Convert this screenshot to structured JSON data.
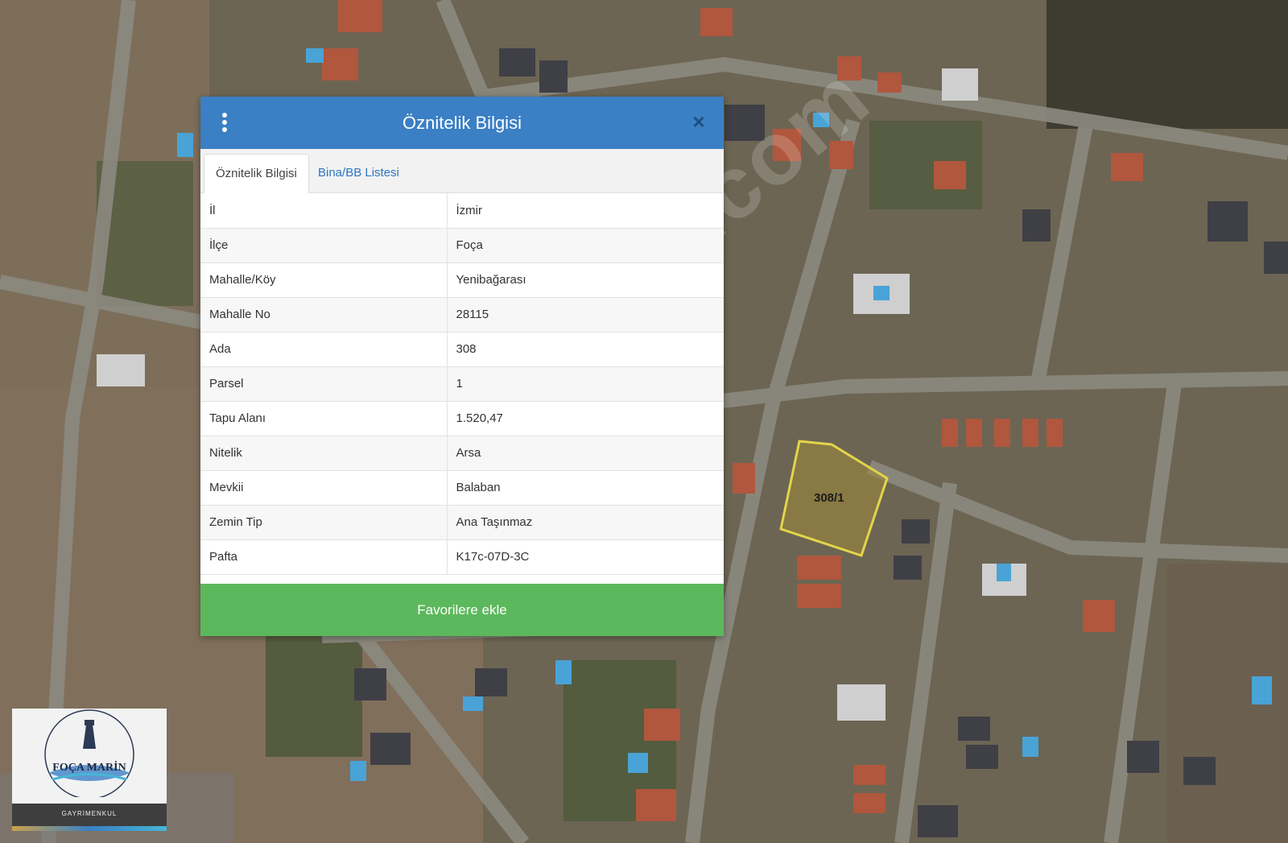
{
  "dialog": {
    "title": "Öznitelik Bilgisi",
    "close_symbol": "×",
    "tabs": [
      {
        "label": "Öznitelik Bilgisi",
        "active": true
      },
      {
        "label": "Bina/BB Listesi",
        "active": false
      }
    ],
    "rows": [
      {
        "key": "İl",
        "value": "İzmir"
      },
      {
        "key": "İlçe",
        "value": "Foça"
      },
      {
        "key": "Mahalle/Köy",
        "value": "Yenibağarası"
      },
      {
        "key": "Mahalle No",
        "value": "28115"
      },
      {
        "key": "Ada",
        "value": "308"
      },
      {
        "key": "Parsel",
        "value": "1"
      },
      {
        "key": "Tapu Alanı",
        "value": "1.520,47"
      },
      {
        "key": "Nitelik",
        "value": "Arsa"
      },
      {
        "key": "Mevkii",
        "value": "Balaban"
      },
      {
        "key": "Zemin Tip",
        "value": "Ana Taşınmaz"
      },
      {
        "key": "Pafta",
        "value": "K17c-07D-3C"
      }
    ],
    "favorite_button": "Favorilere ekle",
    "colors": {
      "header": "#3b7fc4",
      "button": "#5cb85c",
      "link": "#2d77c1"
    }
  },
  "map": {
    "parcel_label": "308/1",
    "watermark": "emlakjet.com"
  },
  "logo": {
    "name": "FOÇA MARİN",
    "subtitle": "GAYRİMENKUL"
  }
}
